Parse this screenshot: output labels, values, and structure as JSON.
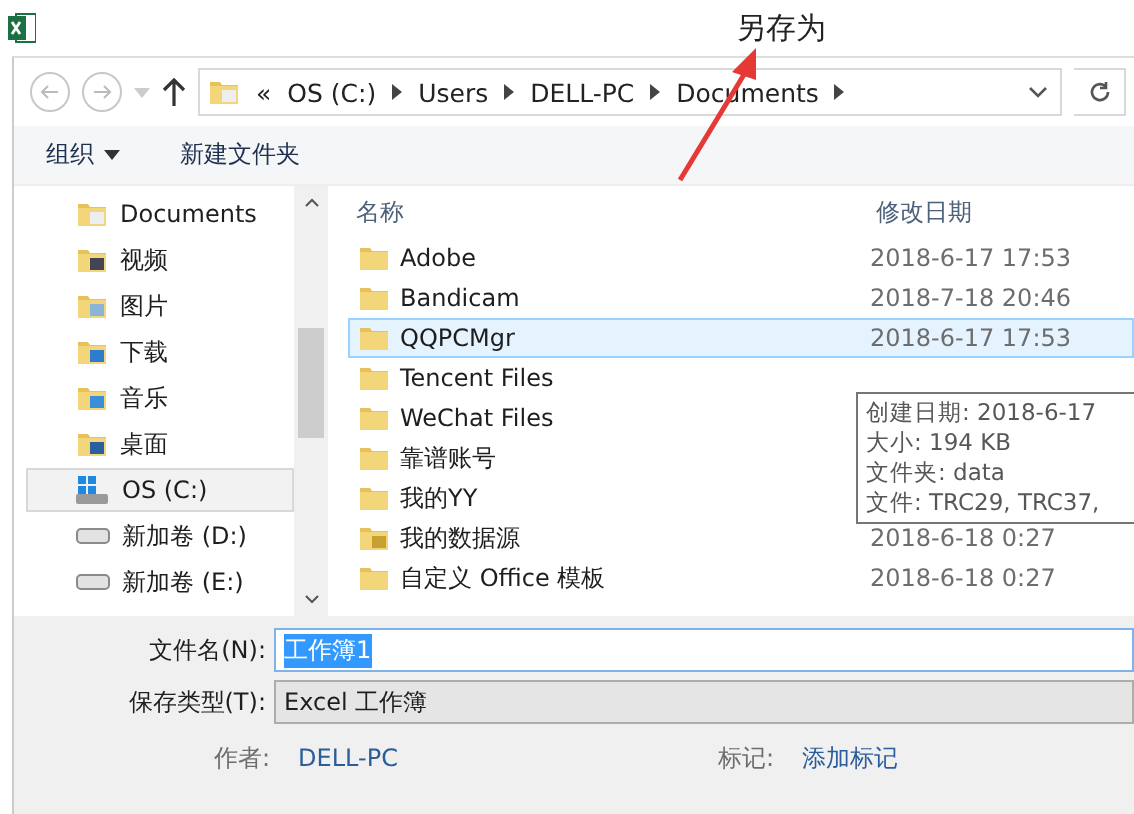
{
  "annotation": {
    "text": "另存为"
  },
  "address": {
    "prefix": "«",
    "path": [
      "OS (C:)",
      "Users",
      "DELL-PC",
      "Documents"
    ]
  },
  "toolbar": {
    "organize": "组织",
    "new_folder": "新建文件夹"
  },
  "sidebar": {
    "items": [
      {
        "label": "Documents",
        "kind": "documents",
        "selected": false
      },
      {
        "label": "视频",
        "kind": "videos",
        "selected": false
      },
      {
        "label": "图片",
        "kind": "pictures",
        "selected": false
      },
      {
        "label": "下载",
        "kind": "downloads",
        "selected": false
      },
      {
        "label": "音乐",
        "kind": "music",
        "selected": false
      },
      {
        "label": "桌面",
        "kind": "desktop",
        "selected": false
      },
      {
        "label": "OS (C:)",
        "kind": "system-drive",
        "selected": true
      },
      {
        "label": "新加卷 (D:)",
        "kind": "drive",
        "selected": false
      },
      {
        "label": "新加卷 (E:)",
        "kind": "drive",
        "selected": false
      }
    ]
  },
  "table": {
    "columns": [
      "名称",
      "修改日期"
    ],
    "rows": [
      {
        "name": "Adobe",
        "date": "2018-6-17 17:53",
        "kind": "folder",
        "selected": false
      },
      {
        "name": "Bandicam",
        "date": "2018-7-18 20:46",
        "kind": "folder",
        "selected": false
      },
      {
        "name": "QQPCMgr",
        "date": "2018-6-17 17:53",
        "kind": "folder",
        "selected": true
      },
      {
        "name": "Tencent Files",
        "kind": "folder",
        "selected": false
      },
      {
        "name": "WeChat Files",
        "kind": "folder",
        "selected": false
      },
      {
        "name": "靠谱账号",
        "kind": "folder",
        "selected": false
      },
      {
        "name": "我的YY",
        "kind": "folder",
        "selected": false
      },
      {
        "name": "我的数据源",
        "date": "2018-6-18 0:27",
        "kind": "datasource",
        "selected": false
      },
      {
        "name": "自定义 Office 模板",
        "date": "2018-6-18 0:27",
        "kind": "folder",
        "selected": false
      }
    ]
  },
  "tooltip": {
    "lines": [
      "创建日期: 2018-6-17",
      "大小: 194 KB",
      "文件夹: data",
      "文件: TRC29, TRC37,"
    ]
  },
  "form": {
    "filename_label": "文件名(N):",
    "filename": "工作簿1",
    "type_label": "保存类型(T):",
    "type": "Excel 工作簿",
    "author_label": "作者:",
    "author": "DELL-PC",
    "tags_label": "标记:",
    "tags_link": "添加标记"
  }
}
